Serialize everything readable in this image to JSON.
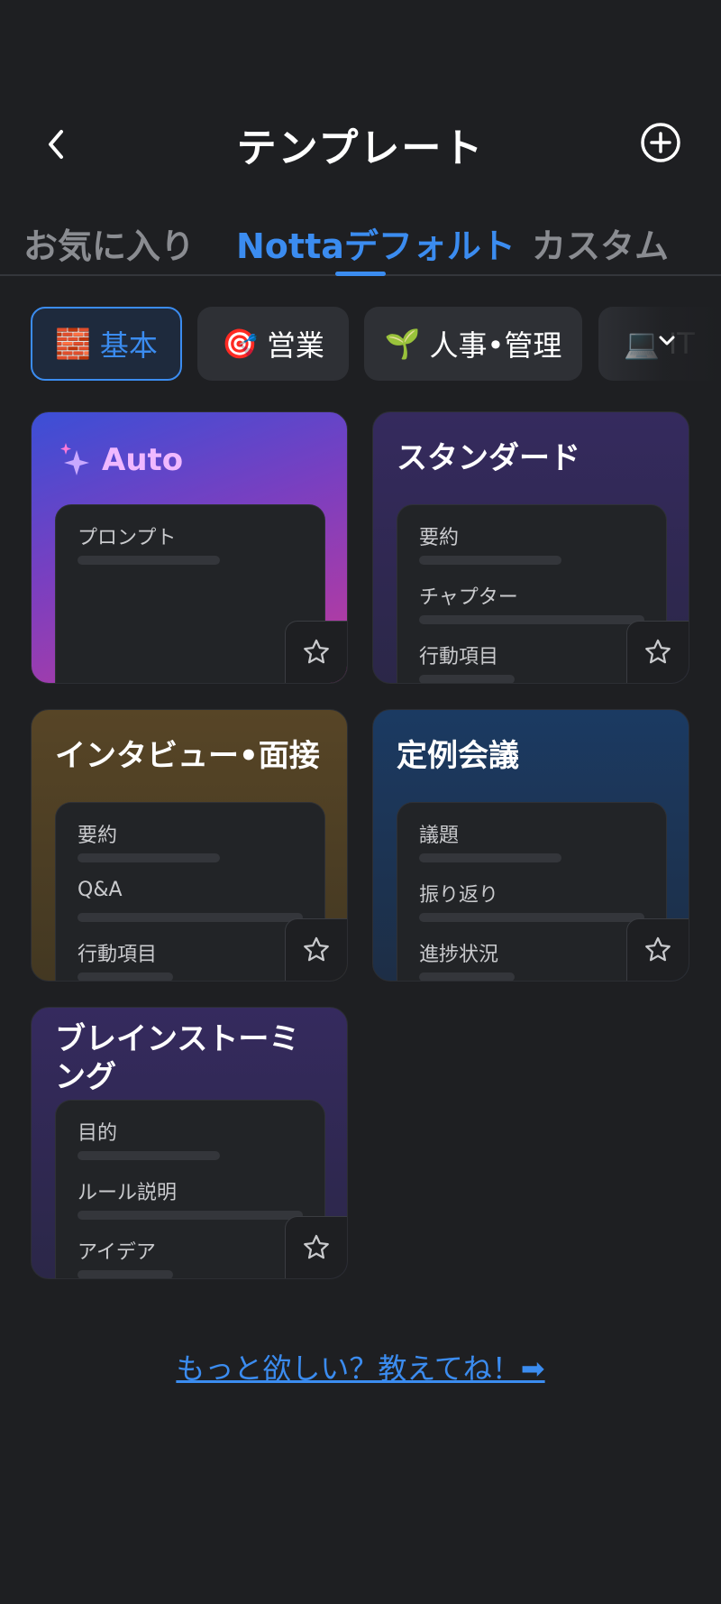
{
  "header": {
    "title": "テンプレート",
    "back_icon": "chevron-left-icon",
    "add_icon": "plus-circle-icon"
  },
  "tabs": [
    {
      "label": "お気に入り",
      "active": false
    },
    {
      "label": "Nottaデフォルト",
      "active": true
    },
    {
      "label": "カスタム",
      "active": false
    }
  ],
  "categories": [
    {
      "emoji": "🧱",
      "label": "基本",
      "active": true
    },
    {
      "emoji": "🎯",
      "label": "営業",
      "active": false
    },
    {
      "emoji": "🌱",
      "label": "人事•管理",
      "active": false
    },
    {
      "emoji": "💻",
      "label": "IT",
      "active": false
    }
  ],
  "templates": [
    {
      "title": "Auto",
      "items": [
        "プロンプト"
      ]
    },
    {
      "title": "スタンダード",
      "items": [
        "要約",
        "チャプター",
        "行動項目"
      ]
    },
    {
      "title": "インタビュー•面接",
      "items": [
        "要約",
        "Q&A",
        "行動項目"
      ]
    },
    {
      "title": "定例会議",
      "items": [
        "議題",
        "振り返り",
        "進捗状況"
      ]
    },
    {
      "title": "ブレインストーミング",
      "items": [
        "目的",
        "ルール説明",
        "アイデア"
      ]
    }
  ],
  "feedback_link": "もっと欲しい？教えてね！➡",
  "colors": {
    "background": "#1e1f22",
    "accent": "#3b8cf0",
    "chip_bg": "#2e3035",
    "inactive_text": "#8a8c91"
  }
}
